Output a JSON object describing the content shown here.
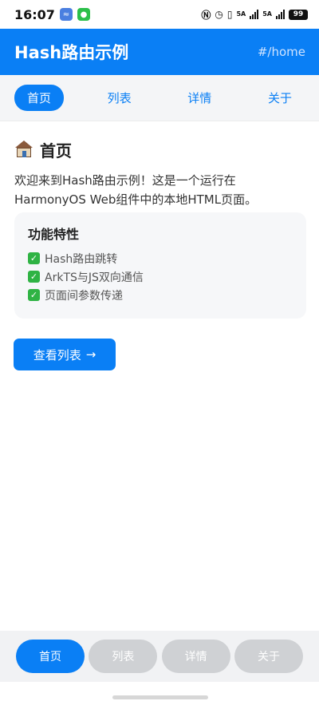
{
  "status_bar": {
    "time": "16:07",
    "net1": "5A",
    "net2": "5A",
    "battery": "99",
    "icons": [
      "nfc-icon",
      "alarm-icon",
      "vibrate-icon",
      "signal-icon",
      "signal-icon",
      "battery-icon"
    ]
  },
  "header": {
    "title": "Hash路由示例",
    "route": "#/home"
  },
  "top_nav": {
    "items": [
      {
        "label": "首页",
        "active": true
      },
      {
        "label": "列表",
        "active": false
      },
      {
        "label": "详情",
        "active": false
      },
      {
        "label": "关于",
        "active": false
      }
    ]
  },
  "main": {
    "title": "首页",
    "intro": "欢迎来到Hash路由示例！这是一个运行在HarmonyOS Web组件中的本地HTML页面。",
    "features": {
      "title": "功能特性",
      "items": [
        "Hash路由跳转",
        "ArkTS与JS双向通信",
        "页面间参数传递"
      ]
    },
    "button_label": "查看列表",
    "button_arrow": "→"
  },
  "bottom_bar": {
    "tabs": [
      {
        "label": "首页",
        "active": true
      },
      {
        "label": "列表",
        "active": false
      },
      {
        "label": "详情",
        "active": false
      },
      {
        "label": "关于",
        "active": false
      }
    ]
  },
  "colors": {
    "primary": "#0a7ff5",
    "success": "#2fb344",
    "inactive_tab": "#cfd1d4"
  }
}
